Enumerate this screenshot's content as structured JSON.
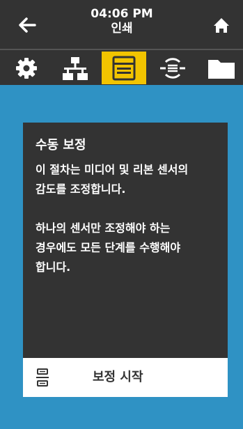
{
  "header": {
    "time": "04:06 PM",
    "title": "인쇄",
    "back_icon": "arrow-left-icon",
    "home_icon": "home-icon"
  },
  "tabs": [
    {
      "icon": "gear-icon",
      "active": false
    },
    {
      "icon": "network-icon",
      "active": false
    },
    {
      "icon": "printer-icon",
      "active": true
    },
    {
      "icon": "sensor-icon",
      "active": false
    },
    {
      "icon": "folder-icon",
      "active": false
    }
  ],
  "card": {
    "title": "수동 보정",
    "paragraph1": [
      "이 절차는 미디어 및 리본 센서의",
      "감도를 조정합니다."
    ],
    "paragraph2": [
      "하나의 센서만 조정해야 하는",
      "경우에도 모든 단계를 수행해야",
      "합니다."
    ]
  },
  "calibration_button": {
    "label": "보정 시작",
    "icon": "calibration-icon"
  },
  "colors": {
    "background": "#2f92c4",
    "bar": "#333333",
    "active_tab": "#f2c400"
  }
}
